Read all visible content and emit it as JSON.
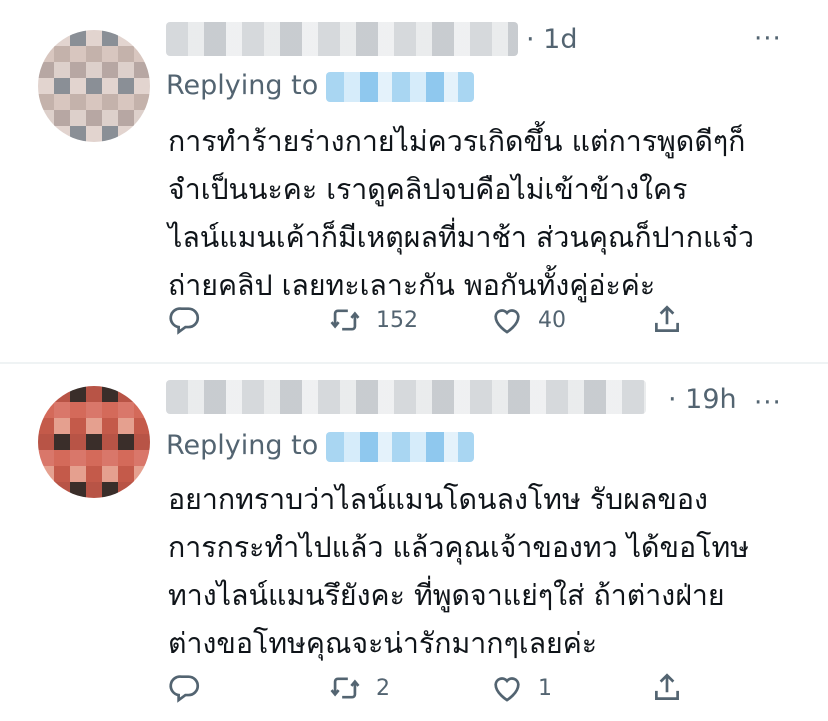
{
  "tweets": [
    {
      "time": "· 1d",
      "more": "···",
      "replying_label": "Replying to",
      "text": "การทำร้ายร่างกายไม่ควรเกิดขึ้น แต่การพูดดีๆก็\nจำเป็นนะคะ เราดูคลิปจบคือไม่เข้าข้างใคร\nไลน์แมนเค้าก็มีเหตุผลที่มาช้า ส่วนคุณก็ปากแจ๋ว\nถ่ายคลิป เลยทะเลาะกัน พอกันทั้งคู่อ่ะค่ะ",
      "retweets": "152",
      "likes": "40",
      "avatar_colors": [
        "#8a8f96",
        "#c9b9b2",
        "#d8c6bf",
        "#6b6f75",
        "#b7a7a3",
        "#9aa0a6",
        "#e2d4cf",
        "#545860",
        "#c4b2ab",
        "#7e848b",
        "#ddd0cb",
        "#a5aab0"
      ]
    },
    {
      "time": "· 19h",
      "more": "···",
      "replying_label": "Replying to",
      "text": "อยากทราบว่าไลน์แมนโดนลงโทษ รับผลของ\nการกระทำไปแล้ว แล้วคุณเจ้าของทว ได้ขอโทษ\nทางไลน์แมนรึยังคะ ที่พูดจาแย่ๆใส่ ถ้าต่างฝ่าย\nต่างขอโทษคุณจะน่ารักมากๆเลยค่ะ",
      "retweets": "2",
      "likes": "1",
      "avatar_colors": [
        "#3a2e2a",
        "#2a2220",
        "#d46a5a",
        "#e07b6a",
        "#c45a4a",
        "#e89a88",
        "#b85446",
        "#f0a595",
        "#d9776a",
        "#c96658",
        "#e5a08f",
        "#a9483c"
      ]
    }
  ]
}
